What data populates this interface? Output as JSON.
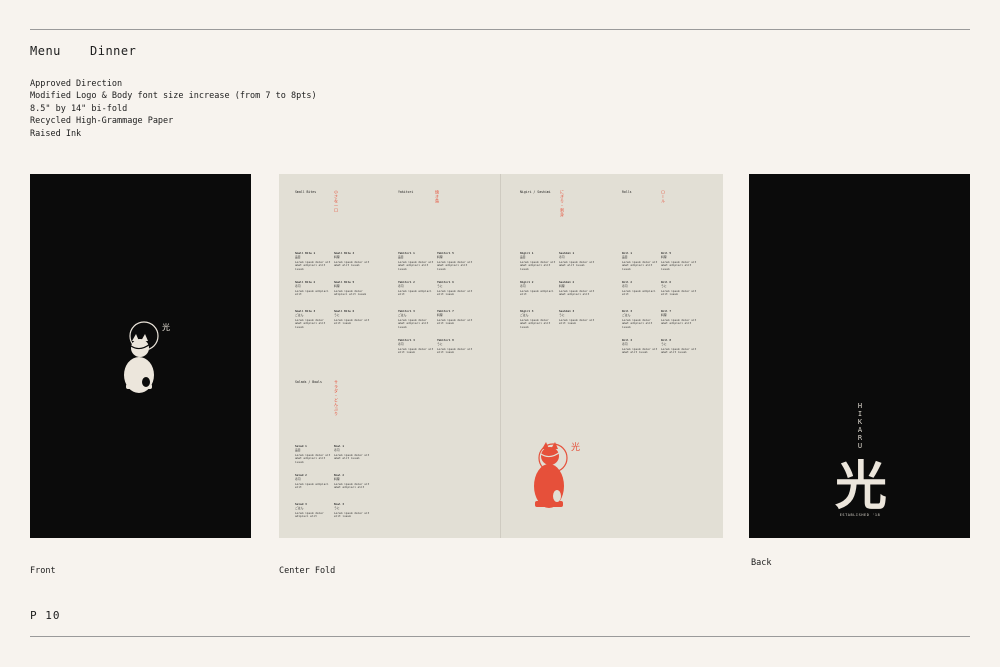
{
  "header": {
    "menu": "Menu",
    "type": "Dinner"
  },
  "notes": [
    "Approved Direction",
    "Modified Logo & Body font size increase (from 7 to 8pts)",
    "8.5\" by 14\" bi-fold",
    "Recycled High-Grammage Paper",
    "Raised Ink"
  ],
  "captions": {
    "front": "Front",
    "center": "Center Fold",
    "back": "Back"
  },
  "page_number": "P 10",
  "logo_kanji": "光",
  "back": {
    "name_letters": [
      "H",
      "I",
      "K",
      "A",
      "R",
      "U"
    ],
    "kanji": "光",
    "established": "ESTABLISHED '18"
  },
  "colors": {
    "background": "#f7f3ee",
    "panel_dark": "#0b0b0b",
    "fold_paper": "#e2dfd5",
    "accent": "#e6503a",
    "cream": "#ece6dc"
  },
  "fold": {
    "sections": [
      {
        "title": "Small Bites",
        "jp": "小さな一口",
        "items": [
          {
            "name": "Small Bite 1",
            "jp": "品目",
            "desc": "Lorem ipsum dolor sit amet adipisci elit iusum"
          },
          {
            "name": "Small Bite 4",
            "jp": "料理",
            "desc": "Lorem ipsum dolor sit amet elit iusum"
          },
          {
            "name": "Small Bite 2",
            "jp": "寿司",
            "desc": "Lorem ipsum adipisci elit"
          },
          {
            "name": "Small Bite 5",
            "jp": "料理",
            "desc": "Lorem ipsum dolor adipisci elit iusum"
          },
          {
            "name": "Small Bite 3",
            "jp": "ごはん",
            "desc": "Lorem ipsum dolor amet adipisci elit iusum"
          },
          {
            "name": "Small Bite 6",
            "jp": "うに",
            "desc": "Lorem ipsum dolor sit elit iusum"
          }
        ]
      },
      {
        "title": "Yakitori",
        "jp": "焼き鳥",
        "items": [
          {
            "name": "Yakitori 1",
            "jp": "品目",
            "desc": "Lorem ipsum dolor sit amet adipisci elit iusum"
          },
          {
            "name": "Yakitori 5",
            "jp": "料理",
            "desc": "Lorem ipsum dolor sit amet adipisci elit iusum"
          },
          {
            "name": "Yakitori 2",
            "jp": "寿司",
            "desc": "Lorem ipsum adipisci elit"
          },
          {
            "name": "Yakitori 6",
            "jp": "うに",
            "desc": "Lorem ipsum dolor sit elit iusum"
          },
          {
            "name": "Yakitori 3",
            "jp": "ごはん",
            "desc": "Lorem ipsum dolor amet adipisci elit iusum"
          },
          {
            "name": "Yakitori 7",
            "jp": "料理",
            "desc": "Lorem ipsum dolor sit elit iusum"
          },
          {
            "name": "Yakitori 4",
            "jp": "寿司",
            "desc": "Lorem ipsum dolor sit elit iusum"
          },
          {
            "name": "Yakitori 8",
            "jp": "うに",
            "desc": "Lorem ipsum dolor sit elit iusum"
          }
        ]
      },
      {
        "title": "Salads / Bowls",
        "jp": "サラダ・どんぶり",
        "items": [
          {
            "name": "Salad 1",
            "jp": "品目",
            "desc": "Lorem ipsum dolor sit amet adipisci elit iusum"
          },
          {
            "name": "Bowl 1",
            "jp": "寿司",
            "desc": "Lorem ipsum dolor sit amet elit iusum"
          },
          {
            "name": "Salad 2",
            "jp": "寿司",
            "desc": "Lorem ipsum adipisci elit"
          },
          {
            "name": "Bowl 2",
            "jp": "料理",
            "desc": "Lorem ipsum dolor sit amet adipisci elit"
          },
          {
            "name": "Salad 3",
            "jp": "ごはん",
            "desc": "Lorem ipsum dolor adipisci elit"
          },
          {
            "name": "Bowl 3",
            "jp": "うに",
            "desc": "Lorem ipsum dolor sit elit iusum"
          }
        ]
      },
      {
        "title": "Nigiri / Sashimi",
        "jp": "にぎり・刺身",
        "items": [
          {
            "name": "Nigiri 1",
            "jp": "品目",
            "desc": "Lorem ipsum dolor sit amet adipisci elit iusum"
          },
          {
            "name": "Sashimi 1",
            "jp": "寿司",
            "desc": "Lorem ipsum dolor sit amet elit iusum"
          },
          {
            "name": "Nigiri 2",
            "jp": "寿司",
            "desc": "Lorem ipsum adipisci elit"
          },
          {
            "name": "Sashimi 2",
            "jp": "料理",
            "desc": "Lorem ipsum dolor sit amet adipisci elit"
          },
          {
            "name": "Nigiri 3",
            "jp": "ごはん",
            "desc": "Lorem ipsum dolor amet adipisci elit iusum"
          },
          {
            "name": "Sashimi 3",
            "jp": "うに",
            "desc": "Lorem ipsum dolor sit elit iusum"
          }
        ]
      },
      {
        "title": "Rolls",
        "jp": "ロール",
        "items": [
          {
            "name": "Roll 1",
            "jp": "品目",
            "desc": "Lorem ipsum dolor sit amet adipisci elit iusum"
          },
          {
            "name": "Roll 5",
            "jp": "料理",
            "desc": "Lorem ipsum dolor sit amet adipisci elit iusum"
          },
          {
            "name": "Roll 2",
            "jp": "寿司",
            "desc": "Lorem ipsum adipisci elit"
          },
          {
            "name": "Roll 6",
            "jp": "うに",
            "desc": "Lorem ipsum dolor sit elit iusum"
          },
          {
            "name": "Roll 3",
            "jp": "ごはん",
            "desc": "Lorem ipsum dolor amet adipisci elit iusum"
          },
          {
            "name": "Roll 7",
            "jp": "料理",
            "desc": "Lorem ipsum dolor sit amet adipisci elit"
          },
          {
            "name": "Roll 4",
            "jp": "寿司",
            "desc": "Lorem ipsum dolor sit amet elit iusum"
          },
          {
            "name": "Roll 8",
            "jp": "うに",
            "desc": "Lorem ipsum dolor sit amet elit iusum"
          }
        ]
      }
    ]
  }
}
